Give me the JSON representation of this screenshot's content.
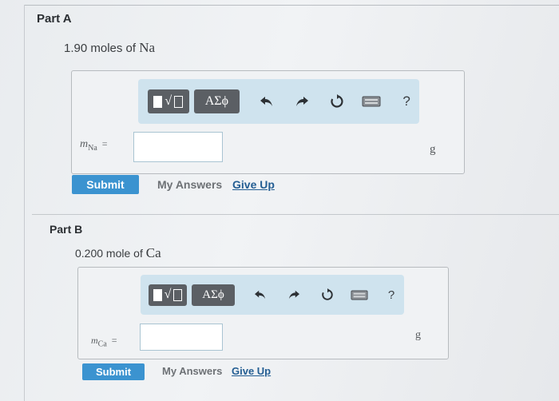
{
  "partA": {
    "title": "Part A",
    "question_prefix": "1.90 moles of ",
    "element": "Na",
    "toolbar": {
      "greek_label": "ΑΣϕ",
      "help_label": "?"
    },
    "variable": {
      "symbol": "m",
      "subscript": "Na",
      "equals": "="
    },
    "input_value": "",
    "unit": "g",
    "submit_label": "Submit",
    "my_answers_label": "My Answers",
    "give_up_label": "Give Up"
  },
  "partB": {
    "title": "Part B",
    "question_prefix": "0.200 mole of ",
    "element": "Ca",
    "toolbar": {
      "greek_label": "ΑΣϕ",
      "help_label": "?"
    },
    "variable": {
      "symbol": "m",
      "subscript": "Ca",
      "equals": "="
    },
    "input_value": "",
    "unit": "g",
    "submit_label": "Submit",
    "my_answers_label": "My Answers",
    "give_up_label": "Give Up"
  },
  "icons": {
    "template": "template-icon",
    "greek": "greek-symbols-icon",
    "undo": "undo-icon",
    "redo": "redo-icon",
    "reset": "reset-icon",
    "keyboard": "keyboard-icon",
    "help": "help-icon"
  }
}
